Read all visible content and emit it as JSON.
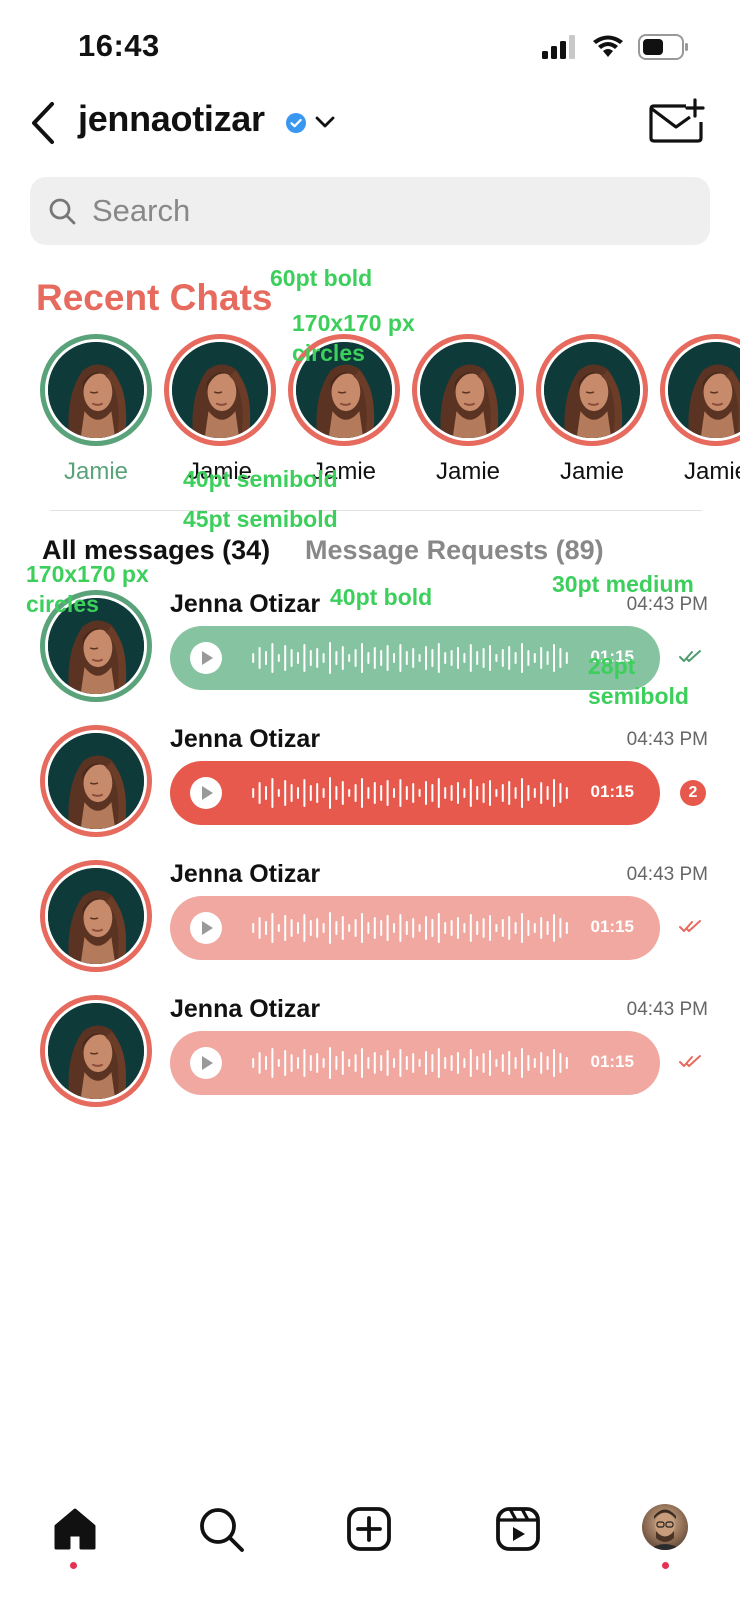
{
  "status_bar": {
    "time": "16:43"
  },
  "header": {
    "username": "jennaotizar"
  },
  "search": {
    "placeholder": "Search"
  },
  "recent_chats": {
    "title": "Recent Chats",
    "stories": [
      {
        "name": "Jamie",
        "seen": true
      },
      {
        "name": "Jamie",
        "seen": false
      },
      {
        "name": "Jamie",
        "seen": false
      },
      {
        "name": "Jamie",
        "seen": false
      },
      {
        "name": "Jamie",
        "seen": false
      },
      {
        "name": "Jamie",
        "seen": false
      }
    ]
  },
  "tabs": {
    "all": "All messages (34)",
    "requests": "Message Requests (89)"
  },
  "messages": [
    {
      "name": "Jenna Otizar",
      "time": "04:43 PM",
      "duration": "01:15",
      "pill_color": "#86c3a0",
      "status": "read-green",
      "unread": ""
    },
    {
      "name": "Jenna Otizar",
      "time": "04:43 PM",
      "duration": "01:15",
      "pill_color": "#e6594c",
      "status": "unread",
      "unread": "2"
    },
    {
      "name": "Jenna Otizar",
      "time": "04:43 PM",
      "duration": "01:15",
      "pill_color": "#f0a8a0",
      "status": "read-red",
      "unread": ""
    },
    {
      "name": "Jenna Otizar",
      "time": "04:43 PM",
      "duration": "01:15",
      "pill_color": "#f0a8a0",
      "status": "read-red",
      "unread": ""
    }
  ],
  "annotations": {
    "a1": "60pt bold",
    "a2_line1": "170x170 px",
    "a2_line2": "circles",
    "a3": "40pt semibold",
    "a4": "45pt semibold",
    "a5_line1": "170x170 px",
    "a5_line2": "circles",
    "a6": "40pt bold",
    "a7": "30pt medium",
    "a8_line1": "28pt",
    "a8_line2": "semibold"
  },
  "icons": {
    "back": "chevron-left-icon",
    "verified": "verified-badge-icon",
    "dropdown": "chevron-down-icon",
    "compose": "new-message-icon",
    "search": "search-icon",
    "nav": [
      "home-icon",
      "search-icon",
      "create-icon",
      "reels-icon",
      "profile-avatar"
    ]
  },
  "colors": {
    "accent_red": "#e66a5d",
    "seen_green": "#5aa27a",
    "annotation_green": "#3dcf5c",
    "nav_dot": "#e6304f"
  }
}
